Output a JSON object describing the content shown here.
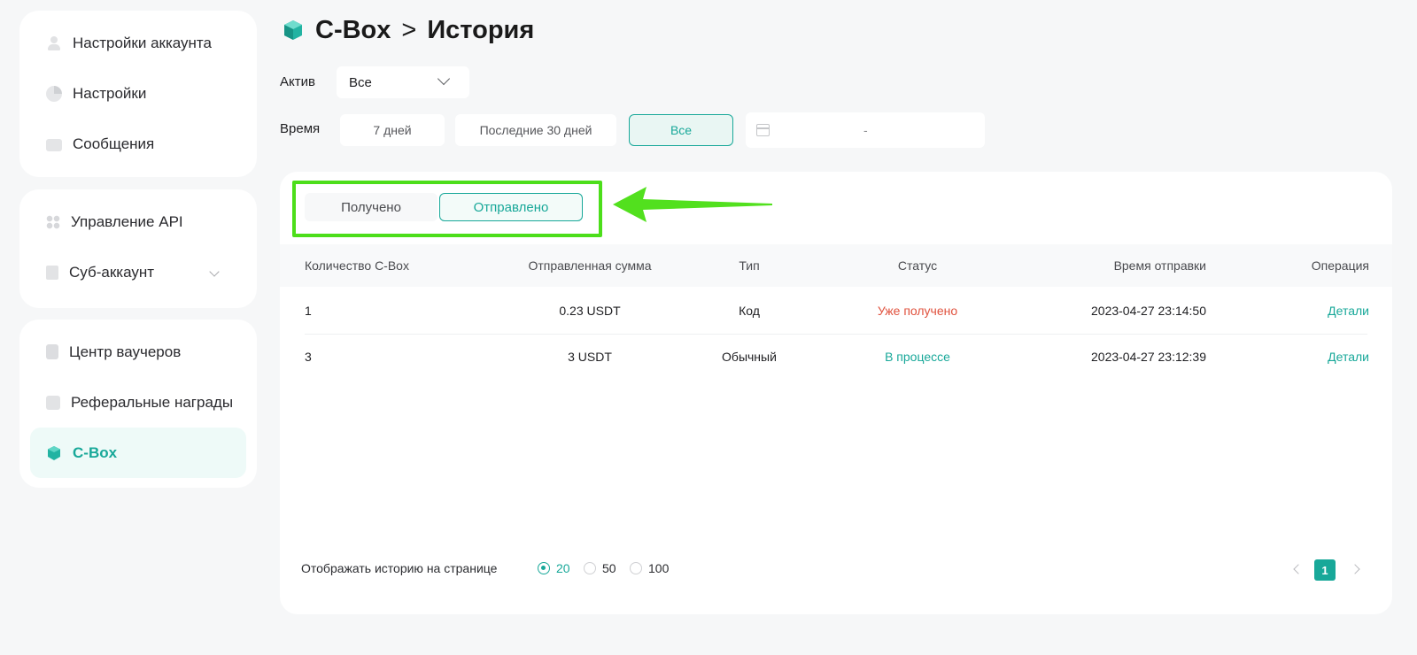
{
  "sidebar": {
    "group1": [
      {
        "label": "Настройки аккаунта",
        "icon": "user-icon"
      },
      {
        "label": "Настройки",
        "icon": "settings-pie-icon"
      },
      {
        "label": "Сообщения",
        "icon": "message-icon"
      }
    ],
    "group2": [
      {
        "label": "Управление API",
        "icon": "api-icon"
      },
      {
        "label": "Суб-аккаунт",
        "icon": "sub-account-icon"
      }
    ],
    "group3": [
      {
        "label": "Центр ваучеров",
        "icon": "voucher-icon"
      },
      {
        "label": "Реферальные награды",
        "icon": "gift-icon"
      },
      {
        "label": "C-Box",
        "icon": "cbox-icon",
        "active": true
      }
    ]
  },
  "header": {
    "breadcrumb_root": "C-Box",
    "separator": ">",
    "title": "История"
  },
  "filters": {
    "asset_label": "Актив",
    "asset_value": "Все",
    "time_label": "Время",
    "time_options": [
      "7 дней",
      "Последние 30 дней",
      "Все"
    ],
    "time_selected": "Все",
    "date_range_separator": "-"
  },
  "tabs": {
    "received": "Получено",
    "sent": "Отправлено",
    "active": "sent"
  },
  "table": {
    "columns": [
      "Количество C-Box",
      "Отправленная сумма",
      "Тип",
      "Статус",
      "Время отправки",
      "Операция"
    ],
    "rows": [
      {
        "count": "1",
        "amount": "0.23 USDT",
        "type": "Код",
        "status": "Уже получено",
        "time": "2023-04-27 23:14:50",
        "action": "Детали"
      },
      {
        "count": "3",
        "amount": "3 USDT",
        "type": "Обычный",
        "status": "В процессе",
        "time": "2023-04-27 23:12:39",
        "action": "Детали"
      }
    ]
  },
  "footer": {
    "per_page_label": "Отображать историю на странице",
    "per_page_options": [
      "20",
      "50",
      "100"
    ],
    "per_page_selected": "20",
    "current_page": "1"
  },
  "colors": {
    "accent": "#18a899",
    "status_done": "#e0513d",
    "highlight": "#4cde1a"
  }
}
